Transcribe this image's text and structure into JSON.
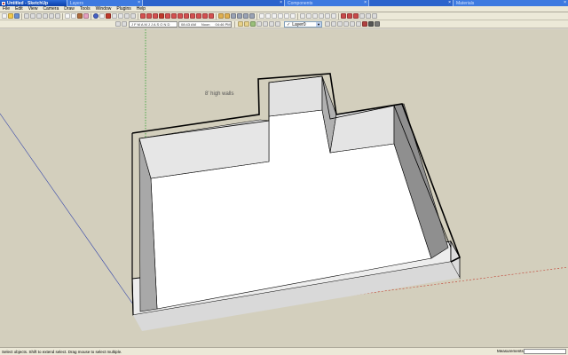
{
  "window": {
    "title": "Untitled - SketchUp",
    "tabs": [
      "Layers",
      "Components",
      "Materials"
    ]
  },
  "menu": [
    "File",
    "Edit",
    "View",
    "Camera",
    "Draw",
    "Tools",
    "Window",
    "Plugins",
    "Help"
  ],
  "toolbar": {
    "layer_name": "Layer0",
    "shadow_time_1": "08:43 AM",
    "shadow_time_noon": "Noon",
    "shadow_time_2": "04:46 PM"
  },
  "viewport": {
    "annotation": "8' high walls"
  },
  "status": {
    "hint": "Select objects. Shift to extend select. Drag mouse to select multiple.",
    "measurements_label": "Measurements"
  },
  "colors": {
    "title_bar": "#0a3fa8",
    "chrome": "#ece9d8",
    "viewport_background": "#d3cfbd",
    "wall_top": "#ffffff",
    "wall_inner_shade": "#a9a9a9",
    "wall_outer_face": "#f0f0f0",
    "axis_green": "#2ca02c",
    "axis_red": "#c0392b",
    "axis_blue": "#3344aa"
  }
}
